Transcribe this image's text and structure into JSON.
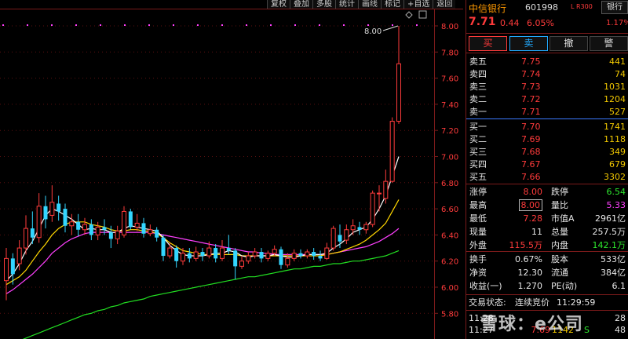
{
  "toolbar": [
    "复权",
    "叠加",
    "多股",
    "统计",
    "画线",
    "标记",
    "+自选",
    "返回"
  ],
  "chart": {
    "y_min": 5.6,
    "y_max": 8.1,
    "y_ticks": [
      "8.00",
      "7.80",
      "7.60",
      "7.40",
      "7.20",
      "7.00",
      "6.80",
      "6.60",
      "6.40",
      "6.20",
      "6.00",
      "5.80"
    ],
    "high_label": "8.00",
    "colors": {
      "up": "#ff3b3b",
      "down": "#33d6ff",
      "ma5": "#ffffff",
      "ma10": "#ffd700",
      "ma20": "#ff40ff",
      "ma60": "#22e022",
      "axis": "#7a1a1a",
      "grid": "#5a1010"
    },
    "candles": [
      [
        6.05,
        6.22,
        6.3,
        5.9
      ],
      [
        6.22,
        6.1,
        6.26,
        6.02
      ],
      [
        6.18,
        6.3,
        6.36,
        6.13
      ],
      [
        6.3,
        6.45,
        6.55,
        6.25
      ],
      [
        6.45,
        6.38,
        6.58,
        6.33
      ],
      [
        6.38,
        6.62,
        6.72,
        6.34
      ],
      [
        6.62,
        6.52,
        6.7,
        6.45
      ],
      [
        6.55,
        6.65,
        6.78,
        6.5
      ],
      [
        6.64,
        6.58,
        6.7,
        6.51
      ],
      [
        6.6,
        6.47,
        6.64,
        6.42
      ],
      [
        6.47,
        6.5,
        6.56,
        6.4
      ],
      [
        6.5,
        6.44,
        6.56,
        6.39
      ],
      [
        6.44,
        6.48,
        6.53,
        6.4
      ],
      [
        6.48,
        6.4,
        6.52,
        6.36
      ],
      [
        6.4,
        6.46,
        6.5,
        6.36
      ],
      [
        6.46,
        6.44,
        6.52,
        6.4
      ],
      [
        6.42,
        6.37,
        6.47,
        6.3
      ],
      [
        6.37,
        6.43,
        6.47,
        6.33
      ],
      [
        6.4,
        6.58,
        6.62,
        6.38
      ],
      [
        6.58,
        6.46,
        6.6,
        6.44
      ],
      [
        6.46,
        6.49,
        6.56,
        6.43
      ],
      [
        6.49,
        6.41,
        6.53,
        6.38
      ],
      [
        6.41,
        6.44,
        6.48,
        6.39
      ],
      [
        6.44,
        6.38,
        6.46,
        6.35
      ],
      [
        6.38,
        6.24,
        6.4,
        6.2
      ],
      [
        6.24,
        6.3,
        6.34,
        6.22
      ],
      [
        6.3,
        6.2,
        6.32,
        6.15
      ],
      [
        6.2,
        6.26,
        6.3,
        6.17
      ],
      [
        6.26,
        6.22,
        6.3,
        6.19
      ],
      [
        6.22,
        6.27,
        6.31,
        6.2
      ],
      [
        6.27,
        6.24,
        6.3,
        6.2
      ],
      [
        6.24,
        6.3,
        6.35,
        6.22
      ],
      [
        6.3,
        6.22,
        6.33,
        6.19
      ],
      [
        6.22,
        6.3,
        6.36,
        6.2
      ],
      [
        6.3,
        6.28,
        6.4,
        6.25
      ],
      [
        6.28,
        6.16,
        6.3,
        6.06
      ],
      [
        6.16,
        6.2,
        6.24,
        6.14
      ],
      [
        6.2,
        6.24,
        6.27,
        6.18
      ],
      [
        6.24,
        6.27,
        6.3,
        6.22
      ],
      [
        6.27,
        6.22,
        6.3,
        6.19
      ],
      [
        6.22,
        6.26,
        6.28,
        6.2
      ],
      [
        6.26,
        6.29,
        6.32,
        6.24
      ],
      [
        6.29,
        6.17,
        6.31,
        6.14
      ],
      [
        6.17,
        6.22,
        6.26,
        6.15
      ],
      [
        6.22,
        6.26,
        6.29,
        6.2
      ],
      [
        6.26,
        6.24,
        6.29,
        6.22
      ],
      [
        6.24,
        6.27,
        6.29,
        6.22
      ],
      [
        6.27,
        6.24,
        6.3,
        6.21
      ],
      [
        6.24,
        6.22,
        6.28,
        6.2
      ],
      [
        6.22,
        6.3,
        6.34,
        6.21
      ],
      [
        6.3,
        6.45,
        6.47,
        6.28
      ],
      [
        6.4,
        6.35,
        6.48,
        6.3
      ],
      [
        6.36,
        6.44,
        6.48,
        6.33
      ],
      [
        6.44,
        6.47,
        6.52,
        6.4
      ],
      [
        6.46,
        6.44,
        6.5,
        6.4
      ],
      [
        6.44,
        6.48,
        6.5,
        6.41
      ],
      [
        6.48,
        6.72,
        6.74,
        6.46
      ],
      [
        6.72,
        6.72,
        6.78,
        6.58
      ],
      [
        6.68,
        6.81,
        6.9,
        6.64
      ],
      [
        6.81,
        7.27,
        7.3,
        6.8
      ],
      [
        7.27,
        7.71,
        8.0,
        7.25
      ]
    ],
    "ma5": [
      6.05,
      6.1,
      6.18,
      6.28,
      6.35,
      6.45,
      6.55,
      6.6,
      6.58,
      6.55,
      6.52,
      6.48,
      6.44,
      6.45,
      6.44,
      6.44,
      6.42,
      6.42,
      6.45,
      6.47,
      6.46,
      6.45,
      6.44,
      6.43,
      6.38,
      6.32,
      6.28,
      6.25,
      6.24,
      6.24,
      6.24,
      6.25,
      6.26,
      6.26,
      6.28,
      6.27,
      6.24,
      6.23,
      6.24,
      6.24,
      6.24,
      6.25,
      6.24,
      6.23,
      6.23,
      6.24,
      6.25,
      6.25,
      6.25,
      6.26,
      6.3,
      6.33,
      6.37,
      6.42,
      6.44,
      6.46,
      6.52,
      6.6,
      6.7,
      6.85,
      7.0
    ],
    "ma10": [
      6.02,
      6.05,
      6.08,
      6.13,
      6.2,
      6.27,
      6.33,
      6.4,
      6.45,
      6.48,
      6.5,
      6.5,
      6.5,
      6.48,
      6.47,
      6.46,
      6.44,
      6.43,
      6.43,
      6.44,
      6.44,
      6.43,
      6.43,
      6.41,
      6.38,
      6.34,
      6.31,
      6.28,
      6.27,
      6.26,
      6.25,
      6.25,
      6.25,
      6.25,
      6.25,
      6.25,
      6.24,
      6.24,
      6.24,
      6.24,
      6.24,
      6.24,
      6.24,
      6.24,
      6.24,
      6.24,
      6.24,
      6.24,
      6.24,
      6.25,
      6.26,
      6.27,
      6.29,
      6.31,
      6.33,
      6.36,
      6.4,
      6.44,
      6.49,
      6.58,
      6.67
    ],
    "ma20": [
      5.95,
      5.98,
      6.02,
      6.06,
      6.1,
      6.15,
      6.2,
      6.26,
      6.3,
      6.34,
      6.37,
      6.39,
      6.41,
      6.42,
      6.42,
      6.42,
      6.42,
      6.42,
      6.42,
      6.42,
      6.42,
      6.42,
      6.42,
      6.41,
      6.4,
      6.39,
      6.38,
      6.37,
      6.36,
      6.35,
      6.34,
      6.33,
      6.32,
      6.31,
      6.3,
      6.29,
      6.28,
      6.27,
      6.27,
      6.26,
      6.26,
      6.25,
      6.25,
      6.25,
      6.25,
      6.25,
      6.25,
      6.25,
      6.25,
      6.25,
      6.26,
      6.27,
      6.28,
      6.29,
      6.3,
      6.31,
      6.33,
      6.35,
      6.38,
      6.41,
      6.45
    ],
    "ma60": [
      5.55,
      5.57,
      5.59,
      5.61,
      5.63,
      5.65,
      5.67,
      5.69,
      5.71,
      5.73,
      5.75,
      5.77,
      5.79,
      5.8,
      5.82,
      5.83,
      5.85,
      5.86,
      5.88,
      5.89,
      5.9,
      5.91,
      5.93,
      5.94,
      5.95,
      5.96,
      5.97,
      5.98,
      5.99,
      6.0,
      6.01,
      6.02,
      6.03,
      6.04,
      6.05,
      6.06,
      6.07,
      6.08,
      6.08,
      6.09,
      6.1,
      6.11,
      6.12,
      6.13,
      6.14,
      6.14,
      6.15,
      6.16,
      6.16,
      6.17,
      6.18,
      6.18,
      6.19,
      6.2,
      6.2,
      6.21,
      6.22,
      6.23,
      6.24,
      6.26,
      6.28
    ]
  },
  "quote": {
    "name": "中信银行",
    "code": "601998",
    "badge": "L R300",
    "sector": "银行",
    "sector_pct": "1.17%",
    "price": "7.71",
    "change": "0.44",
    "pct": "6.05%",
    "buttons": {
      "buy": "买",
      "sell": "卖",
      "cancel": "撤",
      "alert": "警"
    },
    "asks": [
      {
        "label": "卖五",
        "price": "7.75",
        "vol": "441"
      },
      {
        "label": "卖四",
        "price": "7.74",
        "vol": "74"
      },
      {
        "label": "卖三",
        "price": "7.73",
        "vol": "1031"
      },
      {
        "label": "卖二",
        "price": "7.72",
        "vol": "1204"
      },
      {
        "label": "卖一",
        "price": "7.71",
        "vol": "527"
      }
    ],
    "bids": [
      {
        "label": "买一",
        "price": "7.70",
        "vol": "1741"
      },
      {
        "label": "买二",
        "price": "7.69",
        "vol": "1118"
      },
      {
        "label": "买三",
        "price": "7.68",
        "vol": "349"
      },
      {
        "label": "买四",
        "price": "7.67",
        "vol": "679"
      },
      {
        "label": "买五",
        "price": "7.66",
        "vol": "3302"
      }
    ],
    "stats": [
      {
        "l1": "涨停",
        "v1": "8.00",
        "c1": "red",
        "l2": "跌停",
        "v2": "6.54",
        "c2": "green"
      },
      {
        "l1": "最高",
        "v1": "8.00",
        "c1": "red",
        "l2": "量比",
        "v2": "5.33",
        "c2": "mag"
      },
      {
        "l1": "最低",
        "v1": "7.28",
        "c1": "red",
        "l2": "市值A",
        "v2": "2961亿",
        "c2": "white"
      },
      {
        "l1": "现量",
        "v1": "11",
        "c1": "white",
        "l2": "总量",
        "v2": "257.5万",
        "c2": "white"
      },
      {
        "l1": "外盘",
        "v1": "115.5万",
        "c1": "red",
        "l2": "内盘",
        "v2": "142.1万",
        "c2": "green"
      }
    ],
    "stats2": [
      {
        "l1": "换手",
        "v1": "0.67%",
        "l2": "股本",
        "v2": "533亿"
      },
      {
        "l1": "净资",
        "v1": "12.30",
        "l2": "流通",
        "v2": "384亿"
      },
      {
        "l1": "收益(一)",
        "v1": "1.270",
        "l2": "PE(动)",
        "v2": "6.1"
      }
    ],
    "status_label": "交易状态:",
    "status_value": "连续竞价",
    "status_time": "11:29:59",
    "ticks": [
      {
        "time": "11:28",
        "price": "",
        "vol": "",
        "flag": "",
        "num": "28"
      },
      {
        "time": "11:27",
        "price": "7.69",
        "vol": "1142",
        "flag": "S",
        "num": "48"
      }
    ]
  },
  "watermark": "雪球：e公司"
}
